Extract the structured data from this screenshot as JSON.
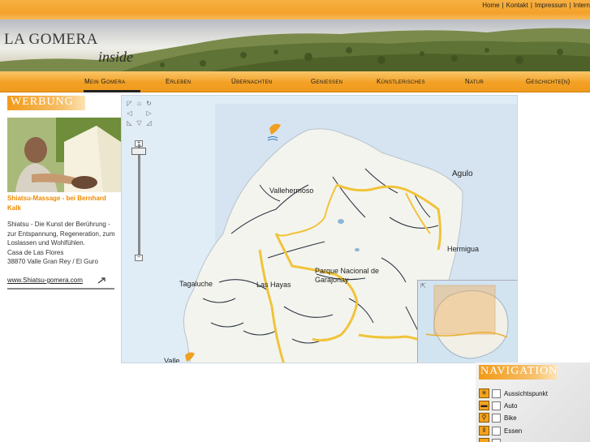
{
  "header": {
    "top_links": [
      "Home",
      "Kontakt",
      "Impressum",
      "Intern"
    ],
    "logo_main": "LA GOMERA",
    "logo_sub": "inside"
  },
  "nav": {
    "items": [
      {
        "label": "Mein Gomera",
        "active": true
      },
      {
        "label": "Erleben",
        "active": false
      },
      {
        "label": "Übernachten",
        "active": false
      },
      {
        "label": "Geniessen",
        "active": false
      },
      {
        "label": "Künstlerisches",
        "active": false
      },
      {
        "label": "Natur",
        "active": false
      },
      {
        "label": "Geschichte(n)",
        "active": false
      }
    ]
  },
  "sidebar": {
    "heading": "WERBUNG",
    "ad_title": "Shiatsu-Massage - bei Bernhard Kalk",
    "ad_text": "Shiatsu - Die Kunst der Berührung - zur Entspannung, Regeneration, zum Loslassen und Wohlfühlen.",
    "ad_address1": "Casa de Las Flores",
    "ad_address2": "38870 Valle Gran Rey / El Guro",
    "ad_link": "www.Shiatsu-gomera.com"
  },
  "map": {
    "place_labels": [
      "Agulo",
      "Vallehermoso",
      "Hermigua",
      "Parque Nacional de Garajonay",
      "Tagaluche",
      "Las Hayas",
      "Valle"
    ],
    "controls": [
      "pan-up",
      "pan-left",
      "pan-right",
      "pan-down",
      "zoom-in",
      "zoom-out"
    ]
  },
  "navigation": {
    "heading": "NAVIGATION",
    "layers": [
      {
        "label": "Aussichtspunkt",
        "icon": "viewpoint-icon",
        "checked": false
      },
      {
        "label": "Auto",
        "icon": "car-icon",
        "checked": false
      },
      {
        "label": "Bike",
        "icon": "bike-icon",
        "checked": false
      },
      {
        "label": "Essen",
        "icon": "restaurant-icon",
        "checked": false
      },
      {
        "label": "",
        "icon": "more-icon",
        "checked": false
      }
    ]
  },
  "colors": {
    "accent": "#f3a125",
    "link_orange": "#f08a00",
    "route_yellow": "#f0c43a",
    "sea": "#e0ecf6",
    "land": "#f4f4ef"
  }
}
